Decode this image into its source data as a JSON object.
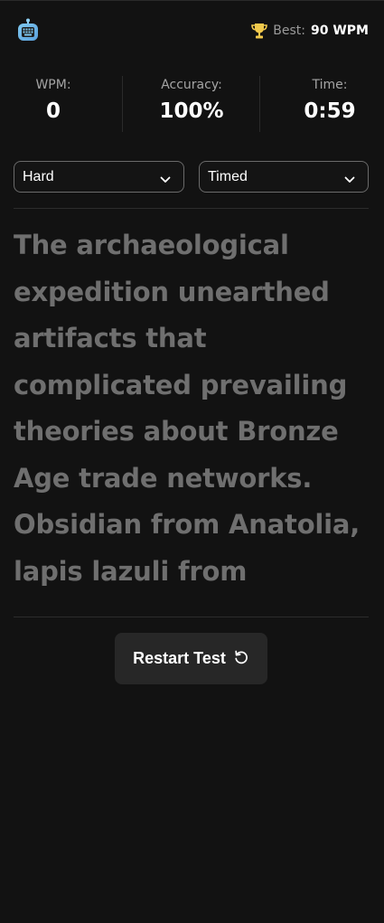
{
  "header": {
    "logo_icon": "keyboard-robot-icon",
    "best_icon": "trophy-icon",
    "best_label": "Best:",
    "best_value": "90 WPM"
  },
  "stats": {
    "wpm_label": "WPM:",
    "wpm_value": "0",
    "accuracy_label": "Accuracy:",
    "accuracy_value": "100%",
    "time_label": "Time:",
    "time_value": "0:59"
  },
  "controls": {
    "difficulty_selected": "Hard",
    "mode_selected": "Timed"
  },
  "passage": {
    "lines": [
      "The archaeological",
      "expedition unearthed",
      "artifacts that",
      "complicated prevailing",
      "theories about Bronze",
      "Age trade networks.",
      "Obsidian from Anatolia,",
      "lapis lazuli from"
    ]
  },
  "actions": {
    "restart_label": "Restart Test",
    "restart_icon": "rotate-ccw-icon"
  },
  "colors": {
    "background": "#121212",
    "passage_text": "#6f6f6f",
    "trophy": "#f2c94c",
    "button_bg": "#272727"
  }
}
